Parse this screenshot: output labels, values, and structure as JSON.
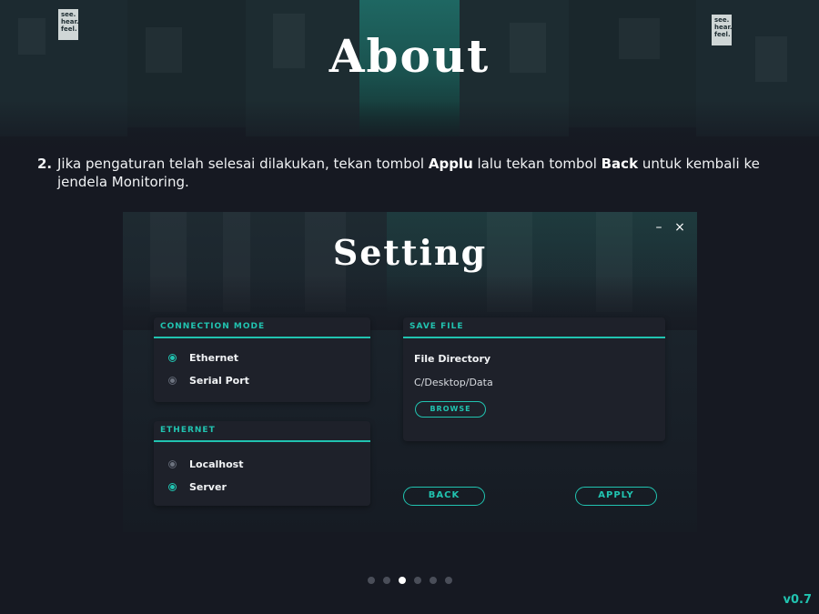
{
  "header": {
    "title": "About"
  },
  "instruction": {
    "number": "2.",
    "parts": [
      "Jika pengaturan telah selesai dilakukan, tekan tombol ",
      "Applu",
      " lalu tekan tombol ",
      "Back",
      " untuk kembali ke jendela Monitoring."
    ]
  },
  "settings_window": {
    "title": "Setting",
    "minimize_icon": "–",
    "close_icon": "×",
    "connection_mode": {
      "header": "CONNECTION MODE",
      "options": [
        {
          "label": "Ethernet",
          "selected": true
        },
        {
          "label": "Serial Port",
          "selected": false
        }
      ]
    },
    "ethernet": {
      "header": "ETHERNET",
      "options": [
        {
          "label": "Localhost",
          "selected": false
        },
        {
          "label": "Server",
          "selected": true
        }
      ]
    },
    "save_file": {
      "header": "SAVE FILE",
      "directory_label": "File Directory",
      "directory_value": "C/Desktop/Data",
      "browse_label": "BROWSE"
    },
    "back_label": "BACK",
    "apply_label": "APPLY",
    "accent_color": "#21c3b0"
  },
  "pagination": {
    "total": 6,
    "active_index": 2
  },
  "version": "v0.7",
  "hero_signs": [
    "see. hear. feel.",
    "see. hear. feel."
  ]
}
